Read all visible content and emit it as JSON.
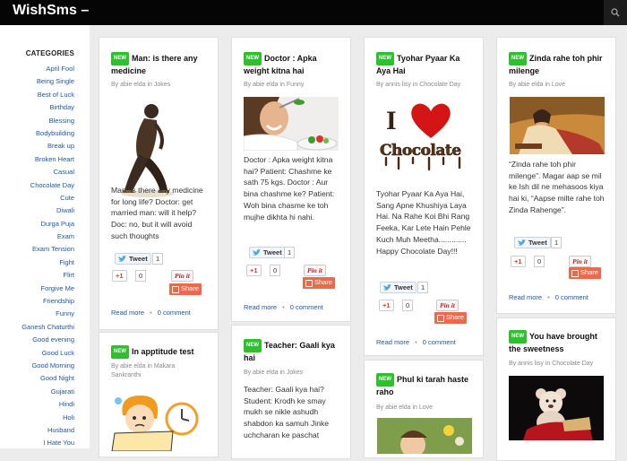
{
  "site_title": "WishSms –",
  "sidebar": {
    "title": "CATEGORIES",
    "items": [
      "April Fool",
      "Being Single",
      "Best of Luck",
      "Birthday",
      "Blessing",
      "Bodybuilding",
      "Break up",
      "Broken Heart",
      "Casual",
      "Chocolate Day",
      "Cute",
      "Diwali",
      "Durga Puja",
      "Exam",
      "Exam Tension",
      "Fight",
      "Flirt",
      "Forgive Me",
      "Friendship",
      "Funny",
      "Ganesh Chaturthi",
      "Good evening",
      "Good Luck",
      "Good Morning",
      "Good Night",
      "Gujarati",
      "Hindi",
      "Holi",
      "Husband",
      "I Hate You"
    ]
  },
  "social": {
    "tweet": "Tweet",
    "gplus": "+1",
    "pin": "Pin it",
    "share": "Share"
  },
  "badge": "NEW",
  "footer": {
    "read_more": "Read more",
    "sep": "•",
    "comments": "0 comment"
  },
  "cards": [
    {
      "title": "Man: is there any medicine",
      "meta": "By abie elda in Jokes",
      "body": "Man: is there any medicine for long life? Doctor: get married man: will it help? Doc: no, but it will avoid such thoughts",
      "tweet_count": "1",
      "gplus_count": "0"
    },
    {
      "title": "In apptitude test",
      "meta": "By abie elda in Makara Sankranthi"
    },
    {
      "title": "Doctor : Apka weight kitna hai",
      "meta": "By abie elda in Funny",
      "body": "Doctor : Apka weight kitna hai? Patient: Chashme ke sath 75 kgs. Doctor : Aur bina chashme ke? Patient: Woh bina chasme ke toh mujhe dikhta hi nahi.",
      "tweet_count": "1",
      "gplus_count": "0"
    },
    {
      "title": "Teacher: Gaali kya hai",
      "meta": "By abie elda in Jokes",
      "body": "Teacher: Gaali kya hai? Student: Krodh ke smay mukh se nikle ashudh shabdon ka samuh Jinke uchcharan ke paschat"
    },
    {
      "title": "Tyohar Pyaar Ka Aya Hai",
      "meta": "By annis lisy in Chocolate Day",
      "body": "Tyohar Pyaar Ka Aya Hai, Sang Apne Khushiya Laya Hai. Na Rahe Koi Bhi Rang Feeka, Kar Lete Hain Pehle Kuch Muh Meetha............. Happy Chocolate Day!!!",
      "tweet_count": "1",
      "gplus_count": "0",
      "image_text": "Chocolate"
    },
    {
      "title": "Phul ki tarah haste raho",
      "meta": "By abie elda in Love"
    },
    {
      "title": "Zinda rahe toh phir milenge",
      "meta": "By abie elda in Love",
      "body": "“Zinda rahe toh phir milenge”. Magar aap se mil ke Ish dil ne mehasoos kiya hai ki, “Aapse milte rahe toh Zinda Rahenge”.",
      "tweet_count": "1",
      "gplus_count": "0"
    },
    {
      "title": "You have brought the sweetness",
      "meta": "By annis lisy in Chocolate Day"
    }
  ]
}
